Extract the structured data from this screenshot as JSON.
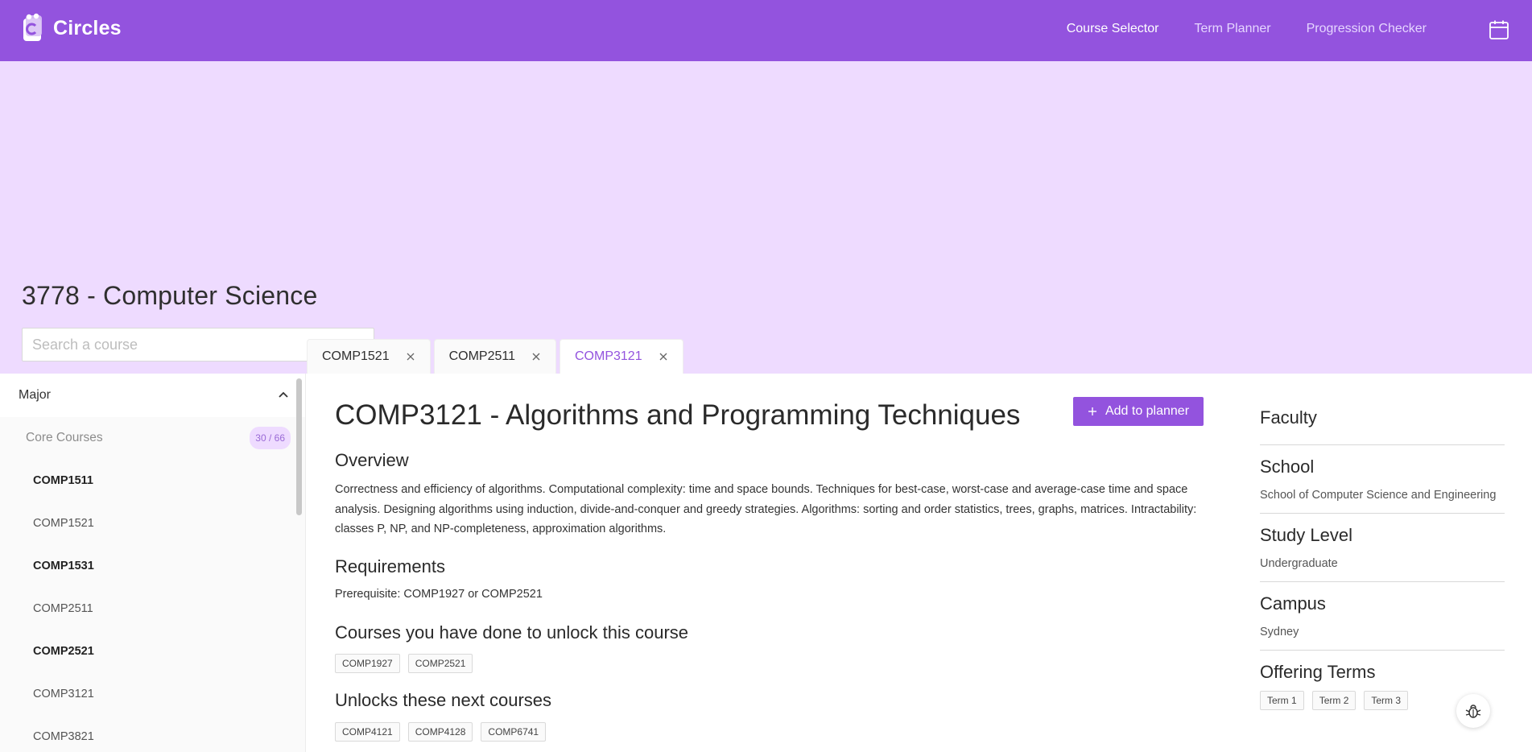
{
  "app": {
    "name": "Circles"
  },
  "nav": {
    "items": [
      "Course Selector",
      "Term Planner",
      "Progression Checker"
    ],
    "active": "Course Selector"
  },
  "program": {
    "title": "3778 - Computer Science"
  },
  "search": {
    "placeholder": "Search a course"
  },
  "tabs": [
    {
      "label": "COMP1521",
      "active": false
    },
    {
      "label": "COMP2511",
      "active": false
    },
    {
      "label": "COMP3121",
      "active": true
    }
  ],
  "sidebar": {
    "header": "Major",
    "group": {
      "label": "Core Courses",
      "count": "30 / 66"
    },
    "items": [
      {
        "code": "COMP1511",
        "bold": true
      },
      {
        "code": "COMP1521",
        "bold": false
      },
      {
        "code": "COMP1531",
        "bold": true
      },
      {
        "code": "COMP2511",
        "bold": false
      },
      {
        "code": "COMP2521",
        "bold": true
      },
      {
        "code": "COMP3121",
        "bold": false
      },
      {
        "code": "COMP3821",
        "bold": false
      }
    ]
  },
  "course": {
    "title": "COMP3121 - Algorithms and Programming Techniques",
    "add_button": "Add to planner",
    "overview_heading": "Overview",
    "overview": "Correctness and efficiency of algorithms. Computational complexity: time and space bounds. Techniques for best-case, worst-case and average-case time and space analysis. Designing algorithms using induction, divide-and-conquer and greedy strategies. Algorithms: sorting and order statistics, trees, graphs, matrices. Intractability: classes P, NP, and NP-completeness, approximation algorithms.",
    "requirements_heading": "Requirements",
    "requirements": "Prerequisite: COMP1927 or COMP2521",
    "unlock_heading": "Courses you have done to unlock this course",
    "unlock_courses": [
      "COMP1927",
      "COMP2521"
    ],
    "next_heading": "Unlocks these next courses",
    "next_courses": [
      "COMP4121",
      "COMP4128",
      "COMP6741"
    ]
  },
  "info": {
    "faculty_heading": "Faculty",
    "school_heading": "School",
    "school": "School of Computer Science and Engineering",
    "level_heading": "Study Level",
    "level": "Undergraduate",
    "campus_heading": "Campus",
    "campus": "Sydney",
    "terms_heading": "Offering Terms",
    "terms": [
      "Term 1",
      "Term 2",
      "Term 3"
    ]
  },
  "colors": {
    "primary": "#9353de",
    "hero_bg": "#eedbff",
    "badge_text": "#9a6ad6"
  },
  "icons": [
    "circles-logo-icon",
    "calendar-icon",
    "chevron-down-icon",
    "close-icon",
    "chevron-up-icon",
    "plus-icon",
    "bug-icon"
  ]
}
